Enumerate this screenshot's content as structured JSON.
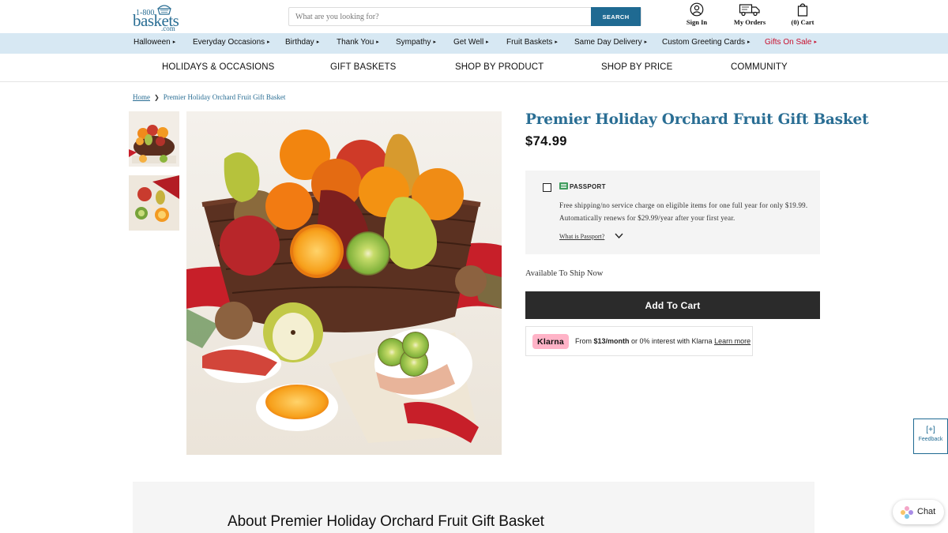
{
  "header": {
    "logo": {
      "top": "1-800",
      "main": "baskets",
      "sub": ".com"
    },
    "search": {
      "placeholder": "What are you looking for?",
      "button_label": "SEARCH"
    },
    "sign_in_label": "Sign In",
    "orders_label": "My Orders",
    "cart_label": "(0) Cart"
  },
  "category_nav": [
    {
      "label": "Halloween"
    },
    {
      "label": "Everyday Occasions"
    },
    {
      "label": "Birthday"
    },
    {
      "label": "Thank You"
    },
    {
      "label": "Sympathy"
    },
    {
      "label": "Get Well"
    },
    {
      "label": "Fruit Baskets"
    },
    {
      "label": "Same Day Delivery"
    },
    {
      "label": "Custom Greeting Cards"
    },
    {
      "label": "Gifts On Sale"
    }
  ],
  "category_arrow": "▸",
  "main_nav": [
    {
      "label": "HOLIDAYS & OCCASIONS"
    },
    {
      "label": "GIFT BASKETS"
    },
    {
      "label": "SHOP BY PRODUCT"
    },
    {
      "label": "SHOP BY PRICE"
    },
    {
      "label": "COMMUNITY"
    }
  ],
  "breadcrumb": {
    "home": "Home",
    "separator": "❯",
    "current": "Premier Holiday Orchard Fruit Gift Basket"
  },
  "product": {
    "title": "Premier Holiday Orchard Fruit Gift Basket",
    "price": "$74.99",
    "availability": "Available To Ship Now",
    "add_to_cart_label": "Add To Cart"
  },
  "passport": {
    "brand": "PASSPORT",
    "description": "Free shipping/no service charge on eligible items for one full year for only $19.99. Automatically renews for $29.99/year after your first year.",
    "link": "What is Passport?"
  },
  "klarna": {
    "badge": "Klarna",
    "prefix": "From ",
    "amount": "$13/month",
    "middle": " or 0% interest with Klarna ",
    "link": "Learn more"
  },
  "feedback": {
    "plus": "[+]",
    "label": "Feedback"
  },
  "about": {
    "title": "About Premier Holiday Orchard Fruit Gift Basket"
  },
  "chat": {
    "label": "Chat"
  },
  "colors": {
    "brand_blue": "#2a6e94",
    "search_button": "#1f6a92",
    "category_bar": "#d7e8f3",
    "sale_red": "#c8102e",
    "add_to_cart": "#2b2b2b",
    "klarna_pink": "#ffb3c7"
  },
  "icons": [
    "basket-logo-icon",
    "user-icon",
    "truck-icon",
    "shopping-bag-icon",
    "passport-icon",
    "chevron-down-icon",
    "chat-flower-icon"
  ]
}
